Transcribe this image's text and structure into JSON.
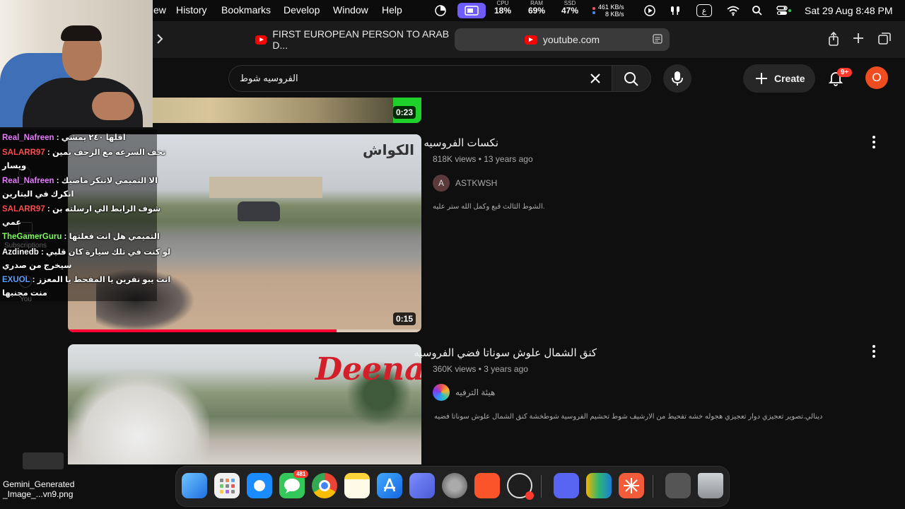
{
  "menubar": {
    "items": [
      "ew",
      "History",
      "Bookmarks",
      "Develop",
      "Window",
      "Help"
    ],
    "cpu": {
      "label": "CPU",
      "value": "18%"
    },
    "ram": {
      "label": "RAM",
      "value": "69%"
    },
    "ssd": {
      "label": "SSD",
      "value": "47%"
    },
    "net": {
      "up": "461 KB/s",
      "down": "8 KB/s"
    },
    "input_source": "ع",
    "datetime": "Sat 29 Aug  8:48 PM"
  },
  "browser": {
    "tab_title": "FIRST EUROPEAN PERSON TO ARAB D...",
    "address": "youtube.com"
  },
  "youtube": {
    "search_query": "الفروسيه شوط",
    "create_label": "Create",
    "notif_badge": "9+",
    "avatar_letter": "O",
    "videos": [
      {
        "duration": "0:23"
      },
      {
        "title": "نكسات الفروسيه",
        "views": "818K views",
        "age": "13 years ago",
        "channel": "ASTKWSH",
        "channel_initial": "A",
        "description": "الشوط الثالث قبع وكمل الله ستر عليه.",
        "duration": "0:15",
        "watermark": "الكواش",
        "progress": 0.76
      },
      {
        "title": "كنق الشمال علوش سوناتا فضي الفروسيه",
        "views": "360K views",
        "age": "3 years ago",
        "channel": "هيئة الترفيه",
        "description": "دينالي.تصوير تعجيزي دوار تعجيزي هجوله خشه تفحيط من الارشيف شوط تحشيم الفروسية شوطخشة كنق الشمال علوش سوناتا فضيه",
        "watermark": "Deenaly"
      }
    ]
  },
  "sidebar_ghost": {
    "subscriptions": "Subscriptions",
    "you": "You"
  },
  "chat": [
    {
      "user": "Real_Nafreen",
      "color": "#e87cff",
      "msg": "اقلها ٢٤٠ يمشي"
    },
    {
      "user": "SALARR97",
      "color": "#ff4d4d",
      "msg": "تخف السرعه مع الزحف يمين",
      "cont": "ويسار"
    },
    {
      "user": "Real_Nafreen",
      "color": "#e87cff",
      "msg": "الا التميمي لاتنكر ماضيك",
      "cont": "انكرك في البتارين"
    },
    {
      "user": "SALARR97",
      "color": "#ff4d4d",
      "msg": "شوف الرابط الي ارسلته بن",
      "cont": "عمي"
    },
    {
      "user": "TheGamerGuru",
      "color": "#7cff5a",
      "msg": "التميمي هل انت فعلتها"
    },
    {
      "user": "Azdinedb",
      "color": "#ffffff",
      "msg": "لو كنت في تلك سيارة كان قلبي",
      "cont": "سيخرج من صدري"
    },
    {
      "user": "EXUOL",
      "color": "#5aa0ff",
      "msg": "انت يبو نفرين يا المفحط يا المعزز",
      "cont": "منت مجنبها"
    }
  ],
  "desktop_file": {
    "name_line1": "Gemini_Generated",
    "name_line2": "_Image_...vn9.png"
  },
  "dock": {
    "messages_badge": "481"
  }
}
